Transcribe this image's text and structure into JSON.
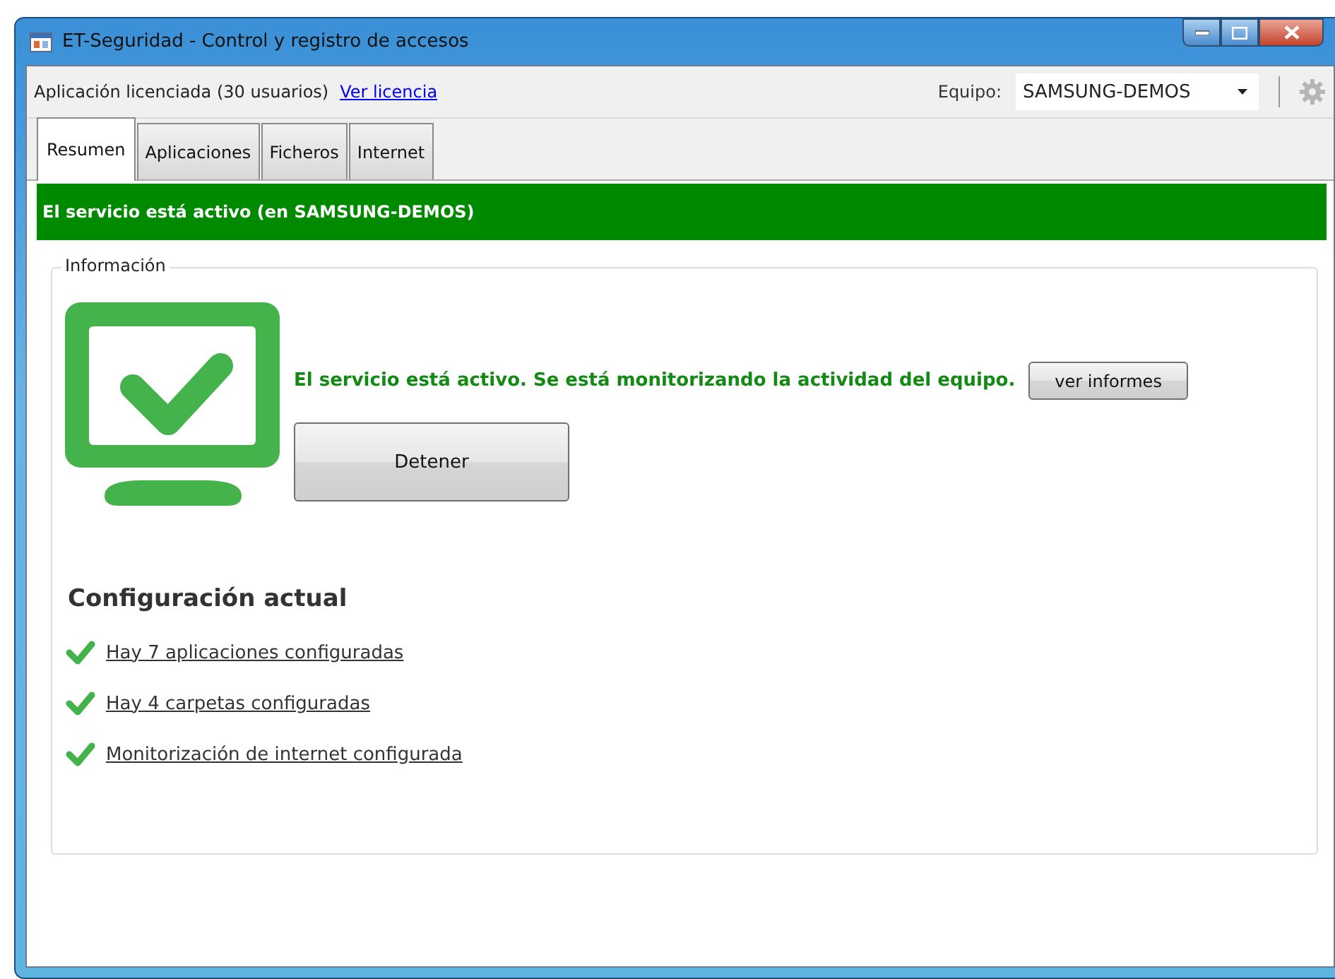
{
  "window": {
    "title": "ET-Seguridad - Control y registro de accesos"
  },
  "toolbar": {
    "license_text": "Aplicación licenciada (30 usuarios)",
    "license_link": "Ver licencia",
    "device_label": "Equipo:",
    "device_value": "SAMSUNG-DEMOS"
  },
  "tabs": [
    {
      "label": "Resumen",
      "selected": true
    },
    {
      "label": "Aplicaciones",
      "selected": false
    },
    {
      "label": "Ficheros",
      "selected": false
    },
    {
      "label": "Internet",
      "selected": false
    }
  ],
  "status_banner": {
    "text": "El servicio está activo (en SAMSUNG-DEMOS)",
    "active": true
  },
  "info_group": {
    "title": "Información",
    "message": "El servicio está activo. Se está monitorizando la actividad del equipo.",
    "report_button": "ver informes",
    "stop_button": "Detener"
  },
  "config": {
    "heading": "Configuración actual",
    "items": [
      {
        "text": "Hay 7 aplicaciones configuradas",
        "checked": true
      },
      {
        "text": "Hay 4 carpetas configuradas",
        "checked": true
      },
      {
        "text": "Monitorización de internet configurada",
        "checked": true
      }
    ]
  }
}
